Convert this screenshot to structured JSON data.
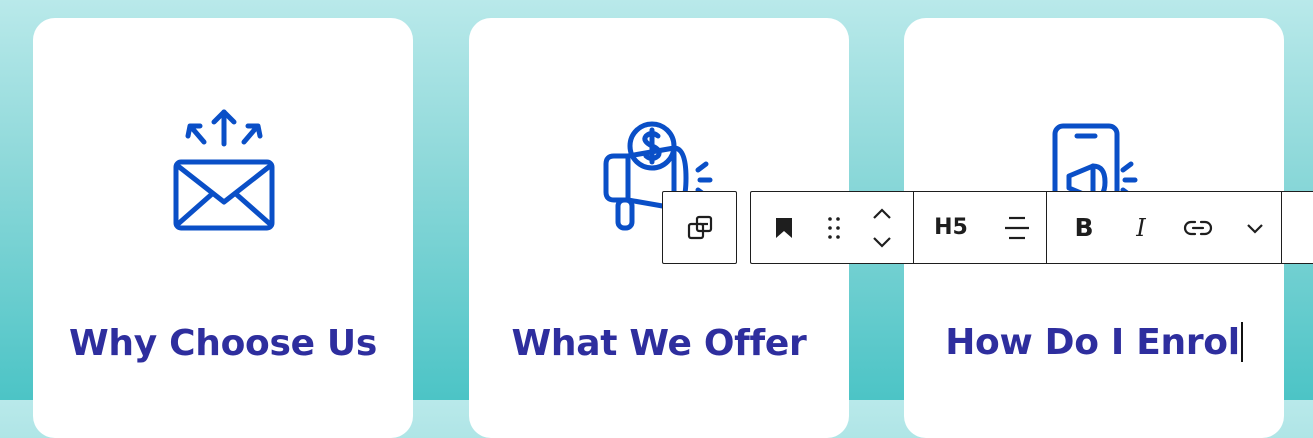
{
  "cards": [
    {
      "title": "Why Choose Us",
      "icon": "envelope-send-icon"
    },
    {
      "title": "What We Offer",
      "icon": "megaphone-dollar-icon"
    },
    {
      "title": "How Do I Enrol",
      "icon": "mobile-megaphone-icon"
    }
  ],
  "toolbar": {
    "heading_level": "H5",
    "bold_label": "B",
    "italic_label": "I",
    "icons": [
      "duplicate-blocks-icon",
      "bookmark-icon",
      "drag-handle-icon",
      "move-up-icon",
      "move-down-icon",
      "align-icon",
      "link-icon",
      "more-options-chevron-icon"
    ]
  },
  "colors": {
    "accent": "#2e2e9e",
    "icon_blue": "#0a4fc7",
    "bg_top": "#b9e9ea",
    "bg_bottom": "#4cc4c6"
  }
}
